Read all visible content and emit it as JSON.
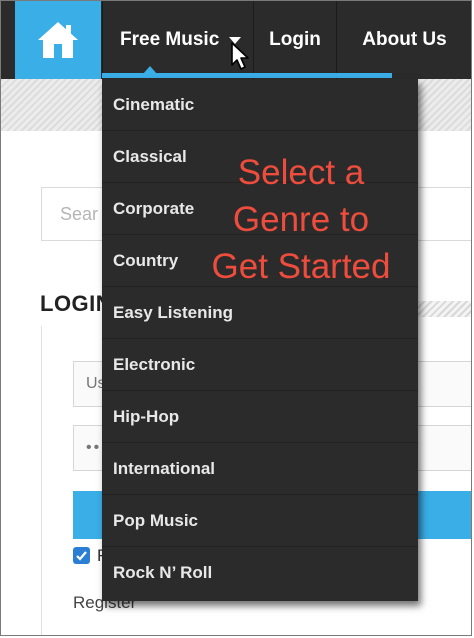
{
  "navbar": {
    "home_icon": "home-icon",
    "items": [
      {
        "label": "Free Music",
        "icon": "chevron-down-icon"
      },
      {
        "label": "Login"
      },
      {
        "label": "About Us"
      }
    ],
    "accent_color": "#3aaee6",
    "background_color": "#2b2b2b"
  },
  "search": {
    "placeholder": "Sear"
  },
  "login": {
    "heading": "LOGIN",
    "username_placeholder": "Us",
    "password_value": "••",
    "remember_label": "R",
    "register_label": "Register"
  },
  "dropdown": {
    "items": [
      {
        "label": "Cinematic"
      },
      {
        "label": "Classical"
      },
      {
        "label": "Corporate"
      },
      {
        "label": "Country"
      },
      {
        "label": "Easy Listening"
      },
      {
        "label": "Electronic"
      },
      {
        "label": "Hip-Hop"
      },
      {
        "label": "International"
      },
      {
        "label": "Pop Music"
      },
      {
        "label": "Rock N’ Roll"
      }
    ]
  },
  "overlay": {
    "lines": [
      "Select a",
      "Genre to",
      "Get Started"
    ],
    "color": "#ee4c3d"
  }
}
